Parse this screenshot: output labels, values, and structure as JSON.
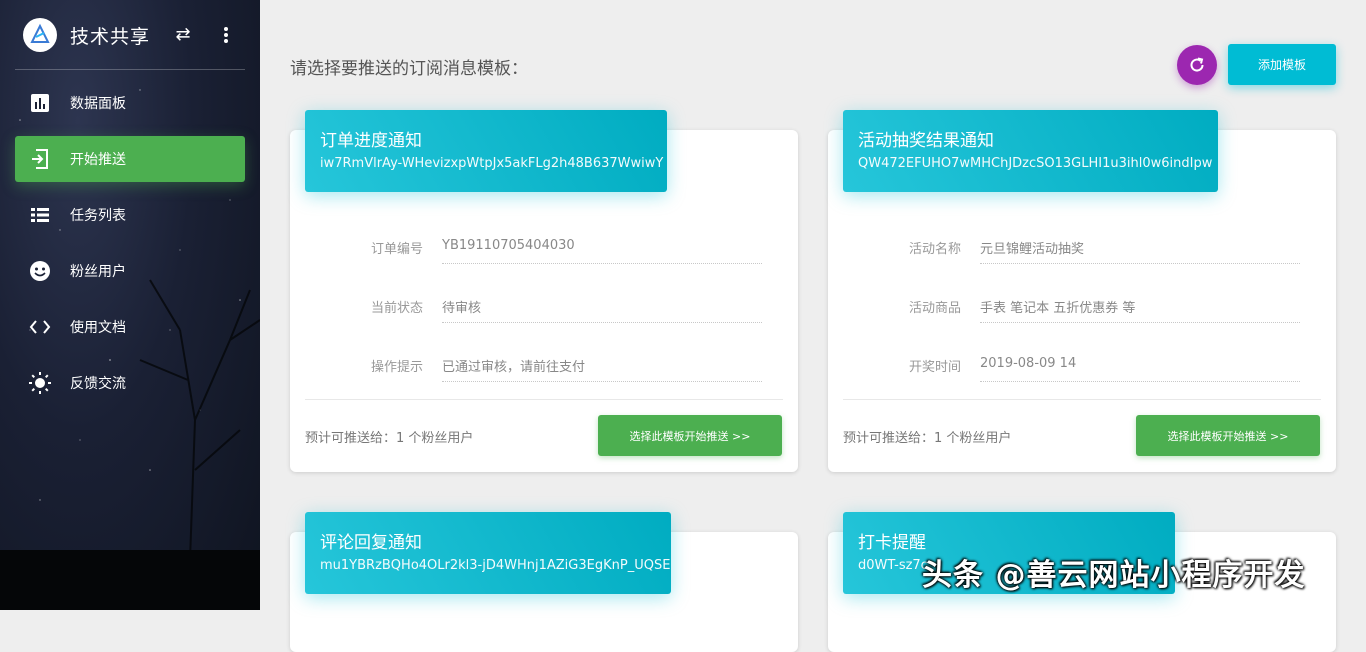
{
  "sidebar": {
    "brand_title": "技术共享",
    "items": [
      {
        "label": "数据面板",
        "icon": "bar-chart-icon"
      },
      {
        "label": "开始推送",
        "icon": "push-icon"
      },
      {
        "label": "任务列表",
        "icon": "list-icon"
      },
      {
        "label": "粉丝用户",
        "icon": "face-icon"
      },
      {
        "label": "使用文档",
        "icon": "code-icon"
      },
      {
        "label": "反馈交流",
        "icon": "sun-icon"
      }
    ],
    "active_index": 1
  },
  "main": {
    "title": "请选择要推送的订阅消息模板：",
    "add_button": "添加模板",
    "cards": [
      {
        "title": "订单进度通知",
        "template_id": "iw7RmVlrAy-WHevizxpWtpJx5akFLg2h48B637WwiwY",
        "fields": [
          {
            "label": "订单编号",
            "value": "YB19110705404030"
          },
          {
            "label": "当前状态",
            "value": "待审核"
          },
          {
            "label": "操作提示",
            "value": "已通过审核，请前往支付"
          }
        ],
        "push_text": "预计可推送给：1 个粉丝用户",
        "push_button": "选择此模板开始推送 >>"
      },
      {
        "title": "活动抽奖结果通知",
        "template_id": "QW472EFUHO7wMHChJDzcSO13GLHI1u3ihl0w6indIpw",
        "fields": [
          {
            "label": "活动名称",
            "value": "元旦锦鲤活动抽奖"
          },
          {
            "label": "活动商品",
            "value": "手表 笔记本 五折优惠券 等"
          },
          {
            "label": "开奖时间",
            "value": "2019-08-09 14"
          }
        ],
        "push_text": "预计可推送给：1 个粉丝用户",
        "push_button": "选择此模板开始推送 >>"
      },
      {
        "title": "评论回复通知",
        "template_id": "mu1YBRzBQHo4OLr2kl3-jD4WHnj1AZiG3EgKnP_UQSE"
      },
      {
        "title": "打卡提醒",
        "template_id": "d0WT-sz7c"
      }
    ]
  },
  "watermark": "头条 @善云网站小程序开发",
  "colors": {
    "accent_cyan": "#00bcd4",
    "active_green": "#4caf50",
    "refresh_purple": "#9c27b0"
  }
}
